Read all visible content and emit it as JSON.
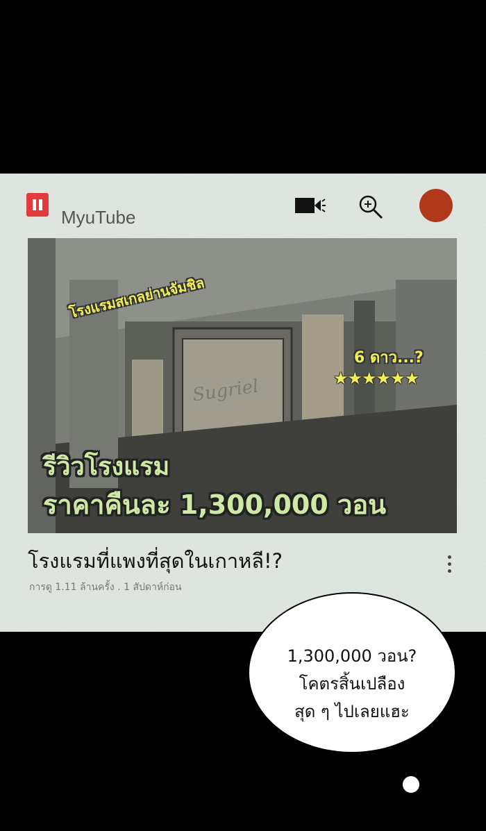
{
  "app": {
    "name": "MyuTube",
    "icons": [
      "logo-icon",
      "video-camera-icon",
      "search-icon",
      "avatar"
    ],
    "logo_color": "#e23b3b",
    "avatar_color": "#b0391c"
  },
  "thumbnail": {
    "tag_location": "โรงแรมสเกลย่านจัมชิล",
    "tag_rating": "6 ดาว...?",
    "stars": "★★★★★★",
    "sign": "Sugriel",
    "headline_line1": "รีวิวโรงแรม",
    "headline_line2": "ราคาคืนละ 1,300,000 วอน"
  },
  "video": {
    "title": "โรงแรมที่แพงที่สุดในเกาหลี!?",
    "meta": "การดู 1.11 ล้านครั้ง . 1 สัปดาห์ก่อน"
  },
  "speech_bubble": {
    "line1": "1,300,000 วอน?",
    "line2": "โคตรสิ้นเปลือง",
    "line3": "สุด ๆ ไปเลยแฮะ"
  }
}
